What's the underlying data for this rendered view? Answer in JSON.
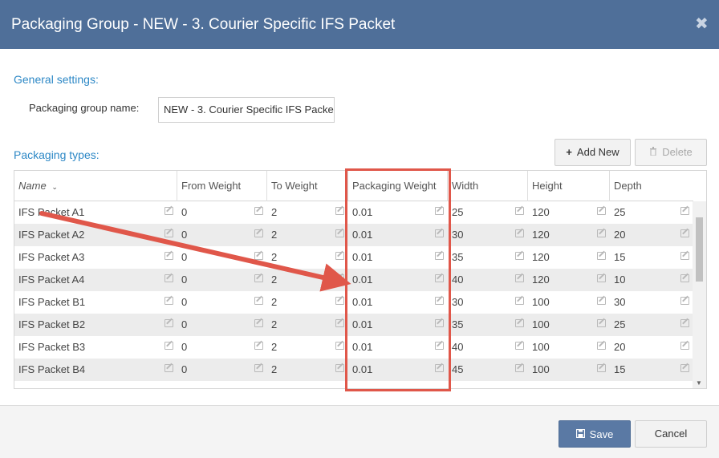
{
  "dialog": {
    "title": "Packaging Group - NEW - 3. Courier Specific IFS Packet",
    "close_icon": "close-icon"
  },
  "general": {
    "section_label": "General settings:",
    "name_label": "Packaging group name:",
    "name_value": "NEW - 3. Courier Specific IFS Packe"
  },
  "types": {
    "section_label": "Packaging types:",
    "add_label": "Add New",
    "add_icon": "plus-icon",
    "delete_label": "Delete",
    "delete_icon": "trash-icon"
  },
  "table": {
    "headers": [
      "Name",
      "From Weight",
      "To Weight",
      "Packaging Weight",
      "Width",
      "Height",
      "Depth"
    ],
    "rows": [
      [
        "IFS Packet A1",
        "0",
        "2",
        "0.01",
        "25",
        "120",
        "25"
      ],
      [
        "IFS Packet A2",
        "0",
        "2",
        "0.01",
        "30",
        "120",
        "20"
      ],
      [
        "IFS Packet A3",
        "0",
        "2",
        "0.01",
        "35",
        "120",
        "15"
      ],
      [
        "IFS Packet A4",
        "0",
        "2",
        "0.01",
        "40",
        "120",
        "10"
      ],
      [
        "IFS Packet B1",
        "0",
        "2",
        "0.01",
        "30",
        "100",
        "30"
      ],
      [
        "IFS Packet B2",
        "0",
        "2",
        "0.01",
        "35",
        "100",
        "25"
      ],
      [
        "IFS Packet B3",
        "0",
        "2",
        "0.01",
        "40",
        "100",
        "20"
      ],
      [
        "IFS Packet B4",
        "0",
        "2",
        "0.01",
        "45",
        "100",
        "15"
      ]
    ],
    "sort_icon": "chevron-down-icon",
    "edit_icon": "edit-icon"
  },
  "footer": {
    "save_label": "Save",
    "save_icon": "floppy-disk-icon",
    "cancel_label": "Cancel"
  },
  "colors": {
    "titlebar": "#4f6f99",
    "accent_text": "#2d88c6",
    "annotation": "#e0574a",
    "save_button": "#5a79a4"
  }
}
